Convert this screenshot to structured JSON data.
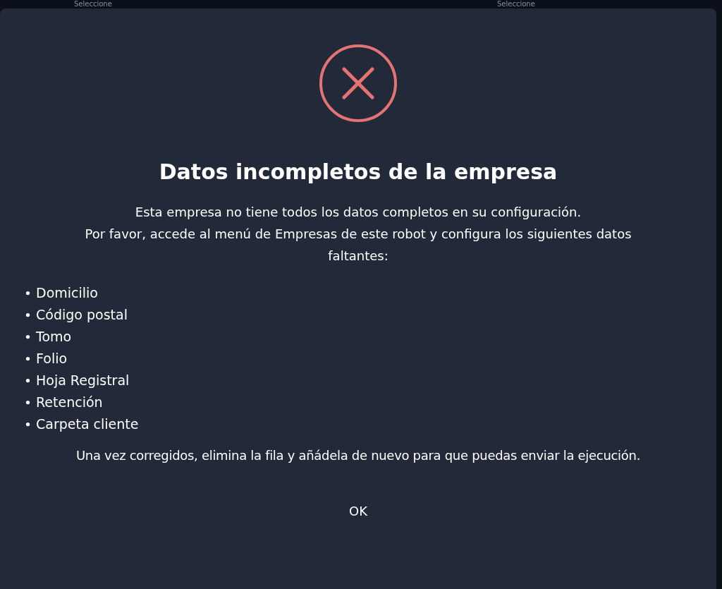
{
  "background": {
    "selects": [
      "Seleccione",
      "Seleccione"
    ]
  },
  "dialog": {
    "title": "Datos incompletos de la empresa",
    "message": [
      "Esta empresa no tiene todos los datos completos en su configuración.",
      "Por favor, accede al menú de Empresas de este robot y configura los siguientes datos faltantes:"
    ],
    "missing": [
      "Domicilio",
      "Código postal",
      "Tomo",
      "Folio",
      "Hoja Registral",
      "Retención",
      "Carpeta cliente"
    ],
    "footer": "Una vez corregidos, elimina la fila y añádela de nuevo para que puedas enviar la ejecución.",
    "button": "OK"
  }
}
